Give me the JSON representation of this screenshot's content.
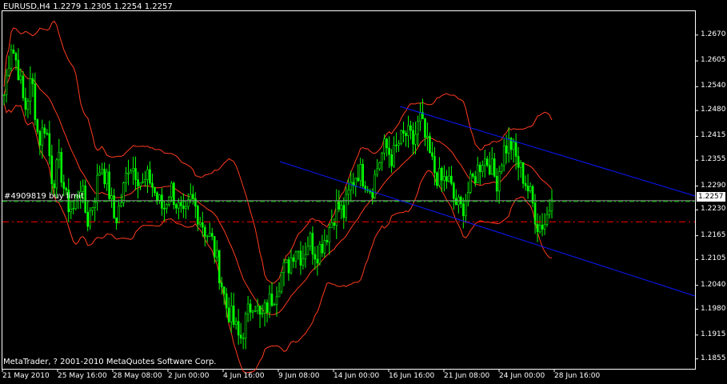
{
  "header": {
    "symbol_text": "EURUSD,H4  1.2279 1.2305 1.2254 1.2257"
  },
  "footer": {
    "copyright": "MetaTrader, ? 2001-2010 MetaQuotes Software Corp."
  },
  "order": {
    "label": "#4909819 buy limit"
  },
  "current_price": "1.2257",
  "colors": {
    "background": "#000000",
    "frame": "#ffffff",
    "candle": "#00ff00",
    "bands": "#ff3b1e",
    "channel": "#0a19ff",
    "bid_line": "#9a9a9a",
    "order_line": "#ff0000",
    "ask_line": "#00c800"
  },
  "chart_data": {
    "type": "candlestick",
    "symbol": "EURUSD",
    "timeframe": "H4",
    "ylim": [
      1.183,
      1.273
    ],
    "price_ticks": [
      "1.2670",
      "1.2605",
      "1.2540",
      "1.2480",
      "1.2415",
      "1.2355",
      "1.2290",
      "1.2230",
      "1.2165",
      "1.2105",
      "1.2040",
      "1.1980",
      "1.1915",
      "1.1855"
    ],
    "time_ticks": [
      "21 May 2010",
      "25 May 16:00",
      "28 May 08:00",
      "2 Jun 00:00",
      "4 Jun 16:00",
      "9 Jun 08:00",
      "14 Jun 00:00",
      "16 Jun 16:00",
      "21 Jun 08:00",
      "24 Jun 00:00",
      "28 Jun 16:00"
    ],
    "last_price": 1.2257,
    "order_price": 1.2253,
    "buy_limit_price": 1.22,
    "closes": [
      1.252,
      1.265,
      1.259,
      1.248,
      1.256,
      1.24,
      1.245,
      1.23,
      1.235,
      1.225,
      1.223,
      1.23,
      1.22,
      1.226,
      1.235,
      1.229,
      1.22,
      1.226,
      1.235,
      1.233,
      1.229,
      1.231,
      1.226,
      1.223,
      1.229,
      1.224,
      1.22,
      1.226,
      1.222,
      1.218,
      1.215,
      1.208,
      1.199,
      1.195,
      1.19,
      1.196,
      1.201,
      1.195,
      1.199,
      1.202,
      1.207,
      1.209,
      1.214,
      1.211,
      1.216,
      1.212,
      1.215,
      1.219,
      1.224,
      1.222,
      1.229,
      1.233,
      1.231,
      1.228,
      1.235,
      1.239,
      1.236,
      1.24,
      1.242,
      1.24,
      1.246,
      1.239,
      1.233,
      1.23,
      1.231,
      1.225,
      1.223,
      1.228,
      1.232,
      1.236,
      1.235,
      1.23,
      1.238,
      1.24,
      1.235,
      1.231,
      1.226,
      1.219,
      1.22,
      1.2257
    ]
  }
}
